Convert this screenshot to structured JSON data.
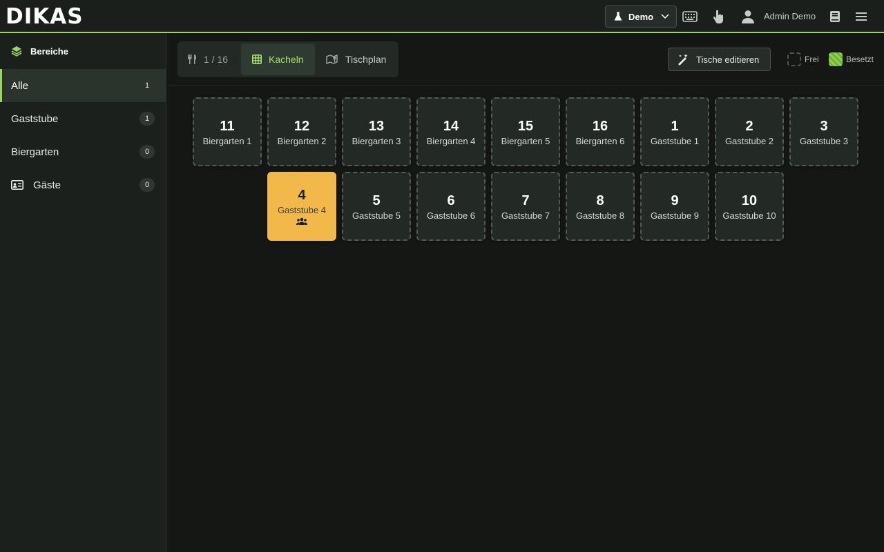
{
  "app": {
    "logo": "DIKAS"
  },
  "header": {
    "demo_label": "Demo",
    "user_name": "Admin Demo"
  },
  "sidebar": {
    "title": "Bereiche",
    "items": [
      {
        "label": "Alle",
        "count": "1",
        "active": true
      },
      {
        "label": "Gaststube",
        "count": "1"
      },
      {
        "label": "Biergarten",
        "count": "0"
      },
      {
        "label": "Gäste",
        "count": "0",
        "icon": "id-card-icon"
      }
    ]
  },
  "toolbar": {
    "counter": "1 / 16",
    "tab_tiles": "Kacheln",
    "tab_plan": "Tischplan",
    "edit_tables": "Tische editieren",
    "legend_free": "Frei",
    "legend_busy": "Besetzt"
  },
  "tables": [
    {
      "number": "11",
      "name": "Biergarten 1",
      "status": "free"
    },
    {
      "number": "12",
      "name": "Biergarten 2",
      "status": "free"
    },
    {
      "number": "13",
      "name": "Biergarten 3",
      "status": "free"
    },
    {
      "number": "14",
      "name": "Biergarten 4",
      "status": "free"
    },
    {
      "number": "15",
      "name": "Biergarten 5",
      "status": "free"
    },
    {
      "number": "16",
      "name": "Biergarten 6",
      "status": "free"
    },
    {
      "number": "1",
      "name": "Gaststube 1",
      "status": "free"
    },
    {
      "number": "2",
      "name": "Gaststube 2",
      "status": "free"
    },
    {
      "number": "3",
      "name": "Gaststube 3",
      "status": "free"
    },
    {
      "number": "4",
      "name": "Gaststube 4",
      "status": "occupied"
    },
    {
      "number": "5",
      "name": "Gaststube 5",
      "status": "free"
    },
    {
      "number": "6",
      "name": "Gaststube 6",
      "status": "free"
    },
    {
      "number": "7",
      "name": "Gaststube 7",
      "status": "free"
    },
    {
      "number": "8",
      "name": "Gaststube 8",
      "status": "free"
    },
    {
      "number": "9",
      "name": "Gaststube 9",
      "status": "free"
    },
    {
      "number": "10",
      "name": "Gaststube 10",
      "status": "free"
    }
  ],
  "colors": {
    "accent": "#9fd26a",
    "occupied": "#f3b84a",
    "background": "#141714"
  }
}
